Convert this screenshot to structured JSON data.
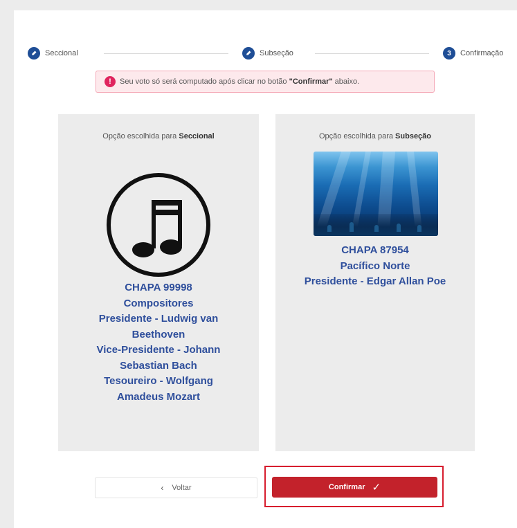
{
  "stepper": {
    "steps": [
      {
        "label": "Seccional",
        "status": "done"
      },
      {
        "label": "Subseção",
        "status": "done"
      },
      {
        "label": "Confirmação",
        "status": "current",
        "number": "3"
      }
    ]
  },
  "alert": {
    "icon": "!",
    "text_before": "Seu voto só será computado após clicar no botão ",
    "text_bold": "\"Confirmar\"",
    "text_after": " abaixo."
  },
  "left_panel": {
    "heading_prefix": "Opção escolhida para ",
    "heading_bold": "Seccional",
    "image_icon": "music-note-icon",
    "lines": [
      "CHAPA 99998",
      "Compositores",
      "Presidente - Ludwig van",
      "Beethoven",
      "Vice-Presidente - Johann",
      "Sebastian Bach",
      "Tesoureiro - Wolfgang",
      "Amadeus Mozart"
    ]
  },
  "right_panel": {
    "heading_prefix": "Opção escolhida para ",
    "heading_bold": "Subseção",
    "image_icon": "ocean-image",
    "lines": [
      "CHAPA 87954",
      "Pacífico Norte",
      "Presidente - Edgar Allan Poe"
    ]
  },
  "buttons": {
    "back_label": "Voltar",
    "confirm_label": "Confirmar"
  },
  "colors": {
    "accent_blue": "#1f4e96",
    "chapa_text": "#2f4f9c",
    "confirm_red": "#c3222b",
    "highlight_border": "#d71d2e",
    "alert_bg": "#fde9ec"
  }
}
